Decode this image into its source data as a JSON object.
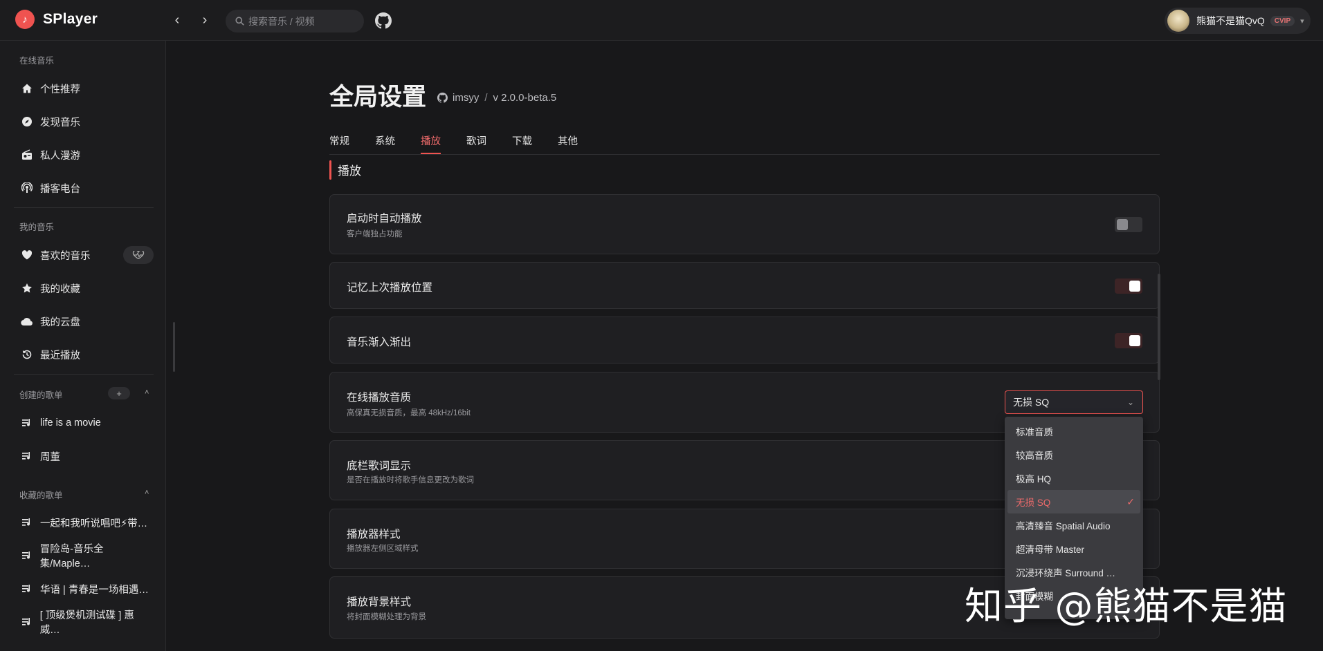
{
  "app": {
    "name": "SPlayer",
    "logo_glyph": "♪"
  },
  "topbar": {
    "back_glyph": "‹",
    "forward_glyph": "›",
    "search_placeholder": "搜索音乐 / 视频",
    "user": {
      "name": "熊猫不是猫QvQ",
      "badge": "CVIP",
      "caret": "▾"
    }
  },
  "sidebar": {
    "online_title": "在线音乐",
    "online_items": [
      {
        "label": "个性推荐",
        "icon": "home-icon"
      },
      {
        "label": "发现音乐",
        "icon": "compass-icon"
      },
      {
        "label": "私人漫游",
        "icon": "radio-icon"
      },
      {
        "label": "播客电台",
        "icon": "podcast-icon"
      }
    ],
    "my_title": "我的音乐",
    "my_items": [
      {
        "label": "喜欢的音乐",
        "icon": "heart-icon"
      },
      {
        "label": "我的收藏",
        "icon": "star-icon"
      },
      {
        "label": "我的云盘",
        "icon": "cloud-icon"
      },
      {
        "label": "最近播放",
        "icon": "history-icon"
      }
    ],
    "created_title": "创建的歌单",
    "created_add": "+",
    "created_items": [
      "life is a movie",
      "周董"
    ],
    "collected_title": "收藏的歌单",
    "collected_items": [
      "一起和我听说唱吧⚡带…",
      "冒险岛-音乐全集/Maple…",
      "华语 | 青春是一场相遇…",
      "[ 顶级煲机测试碟 ] 惠威…"
    ],
    "chevron": "˄"
  },
  "main": {
    "title": "全局设置",
    "repo_user": "imsyy",
    "repo_sep": "/",
    "version": "v 2.0.0-beta.5",
    "tabs": [
      "常规",
      "系统",
      "播放",
      "歌词",
      "下载",
      "其他"
    ],
    "active_tab": "播放",
    "section_title": "播放",
    "settings": [
      {
        "title": "启动时自动播放",
        "desc": "客户端独占功能",
        "control": "switch",
        "on": false
      },
      {
        "title": "记忆上次播放位置",
        "desc": "",
        "control": "switch",
        "on": true
      },
      {
        "title": "音乐渐入渐出",
        "desc": "",
        "control": "switch",
        "on": true
      },
      {
        "title": "在线播放音质",
        "desc": "高保真无损音质，最高 48kHz/16bit",
        "control": "select"
      },
      {
        "title": "底栏歌词显示",
        "desc": "是否在播放时将歌手信息更改为歌词",
        "control": "none"
      },
      {
        "title": "播放器样式",
        "desc": "播放器左侧区域样式",
        "control": "none"
      },
      {
        "title": "播放背景样式",
        "desc": "将封面模糊处理为背景",
        "control": "none"
      }
    ],
    "quality_select": {
      "value": "无损 SQ",
      "caret": "⌄",
      "options": [
        "标准音质",
        "较高音质",
        "极高 HQ",
        "无损 SQ",
        "高清臻音 Spatial Audio",
        "超清母带 Master",
        "沉浸环绕声 Surround …",
        "封面模糊"
      ],
      "selected_index": 3,
      "check_glyph": "✓"
    }
  },
  "watermark": "知乎 @熊猫不是猫",
  "colors": {
    "accent": "#ef5350",
    "background": "#18181a",
    "surface": "#1f1f22"
  }
}
